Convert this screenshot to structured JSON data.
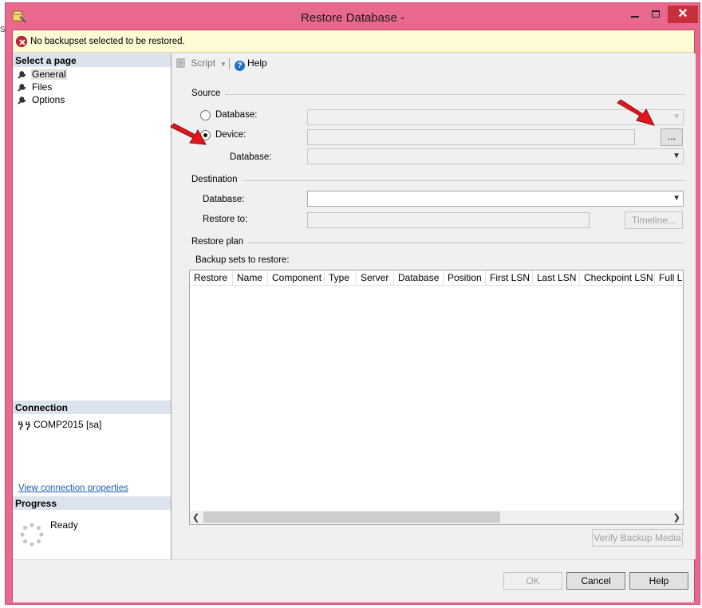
{
  "window": {
    "title": "Restore Database -",
    "close_glyph": "✕"
  },
  "fragment_text": "St",
  "infobar": {
    "message": "No backupset selected to be restored."
  },
  "left_pane": {
    "select_page_title": "Select a page",
    "pages": [
      {
        "label": "General",
        "icon": "wrench-icon"
      },
      {
        "label": "Files",
        "icon": "wrench-icon"
      },
      {
        "label": "Options",
        "icon": "wrench-icon"
      }
    ],
    "connection_title": "Connection",
    "connection_label": "COMP2015 [sa]",
    "view_connection_link": "View connection properties",
    "progress_title": "Progress",
    "progress_status": "Ready"
  },
  "toolbar": {
    "script_label": "Script",
    "help_label": "Help",
    "help_glyph": "?"
  },
  "source": {
    "group_label": "Source",
    "database_radio_label": "Database:",
    "device_radio_label": "Device:",
    "device_database_label": "Database:",
    "browse_label": "...",
    "selected": "device"
  },
  "destination": {
    "group_label": "Destination",
    "database_label": "Database:",
    "restore_to_label": "Restore to:",
    "timeline_label": "Timeline..."
  },
  "restore_plan": {
    "group_label": "Restore plan",
    "backup_sets_label": "Backup sets to restore:",
    "columns": [
      "Restore",
      "Name",
      "Component",
      "Type",
      "Server",
      "Database",
      "Position",
      "First LSN",
      "Last LSN",
      "Checkpoint LSN",
      "Full LS"
    ],
    "verify_label": "Verify Backup Media"
  },
  "footer": {
    "ok_label": "OK",
    "cancel_label": "Cancel",
    "help_label": "Help"
  },
  "colors": {
    "title_bar": "#e9688d",
    "close_button": "#c7303a",
    "infobar": "#fdfbd3",
    "section_header": "#dbe4ee",
    "link": "#1a5fb4",
    "annotation_arrow": "#e3141b"
  }
}
